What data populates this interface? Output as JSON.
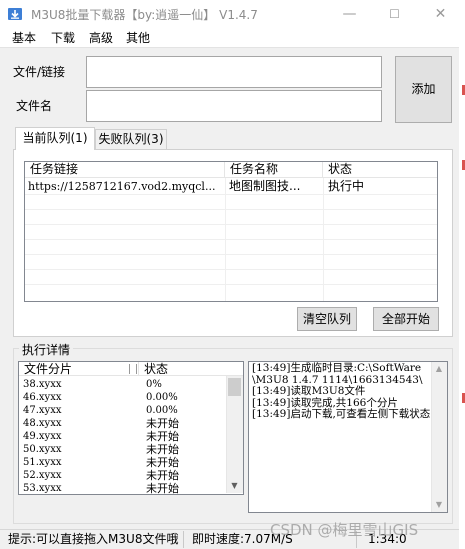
{
  "window": {
    "title": "M3U8批量下载器【by:逍遥一仙】  V1.4.7",
    "min_glyph": "—",
    "max_glyph": "☐",
    "close_glyph": "✕"
  },
  "menu": {
    "items": [
      "基本",
      "下载",
      "高级",
      "其他"
    ]
  },
  "form": {
    "file_link_label": "文件/链接",
    "file_link_value": "",
    "filename_label": "文件名",
    "filename_value": "",
    "add_button": "添加"
  },
  "tabs": {
    "current": "当前队列(1)",
    "failed": "失败队列(3)"
  },
  "task_table": {
    "columns": [
      "任务链接",
      "任务名称",
      "状态"
    ],
    "rows": [
      {
        "link": "https://1258712167.vod2.myqcl...",
        "name": "地图制图技...",
        "status": "执行中"
      }
    ]
  },
  "buttons": {
    "clear_queue": "清空队列",
    "start_all": "全部开始"
  },
  "detail": {
    "title": "执行详情",
    "segment_columns": [
      "文件分片",
      "状态"
    ],
    "segments": [
      {
        "file": "38.xyxx",
        "status": "0%"
      },
      {
        "file": "46.xyxx",
        "status": "0.00%"
      },
      {
        "file": "47.xyxx",
        "status": "0.00%"
      },
      {
        "file": "48.xyxx",
        "status": "未开始"
      },
      {
        "file": "49.xyxx",
        "status": "未开始"
      },
      {
        "file": "50.xyxx",
        "status": "未开始"
      },
      {
        "file": "51.xyxx",
        "status": "未开始"
      },
      {
        "file": "52.xyxx",
        "status": "未开始"
      },
      {
        "file": "53.xyxx",
        "status": "未开始"
      }
    ],
    "log": "[13:49]生成临时目录:C:\\SoftWare\\M3U8 1.4.7 1114\\1663134543\\\n[13:49]读取M3U8文件\n[13:49]读取完成,共166个分片\n[13:49]启动下载,可查看左侧下载状态"
  },
  "status": {
    "hint": "提示:可以直接拖入M3U8文件哦",
    "speed": "即时速度:7.07M/S",
    "time": "1:34:0"
  },
  "watermark": "CSDN @梅里雪山GIS",
  "colors": {
    "client_bg": "#f0f0f0",
    "title_text": "#8c8c8c",
    "list_border": "#828790"
  }
}
